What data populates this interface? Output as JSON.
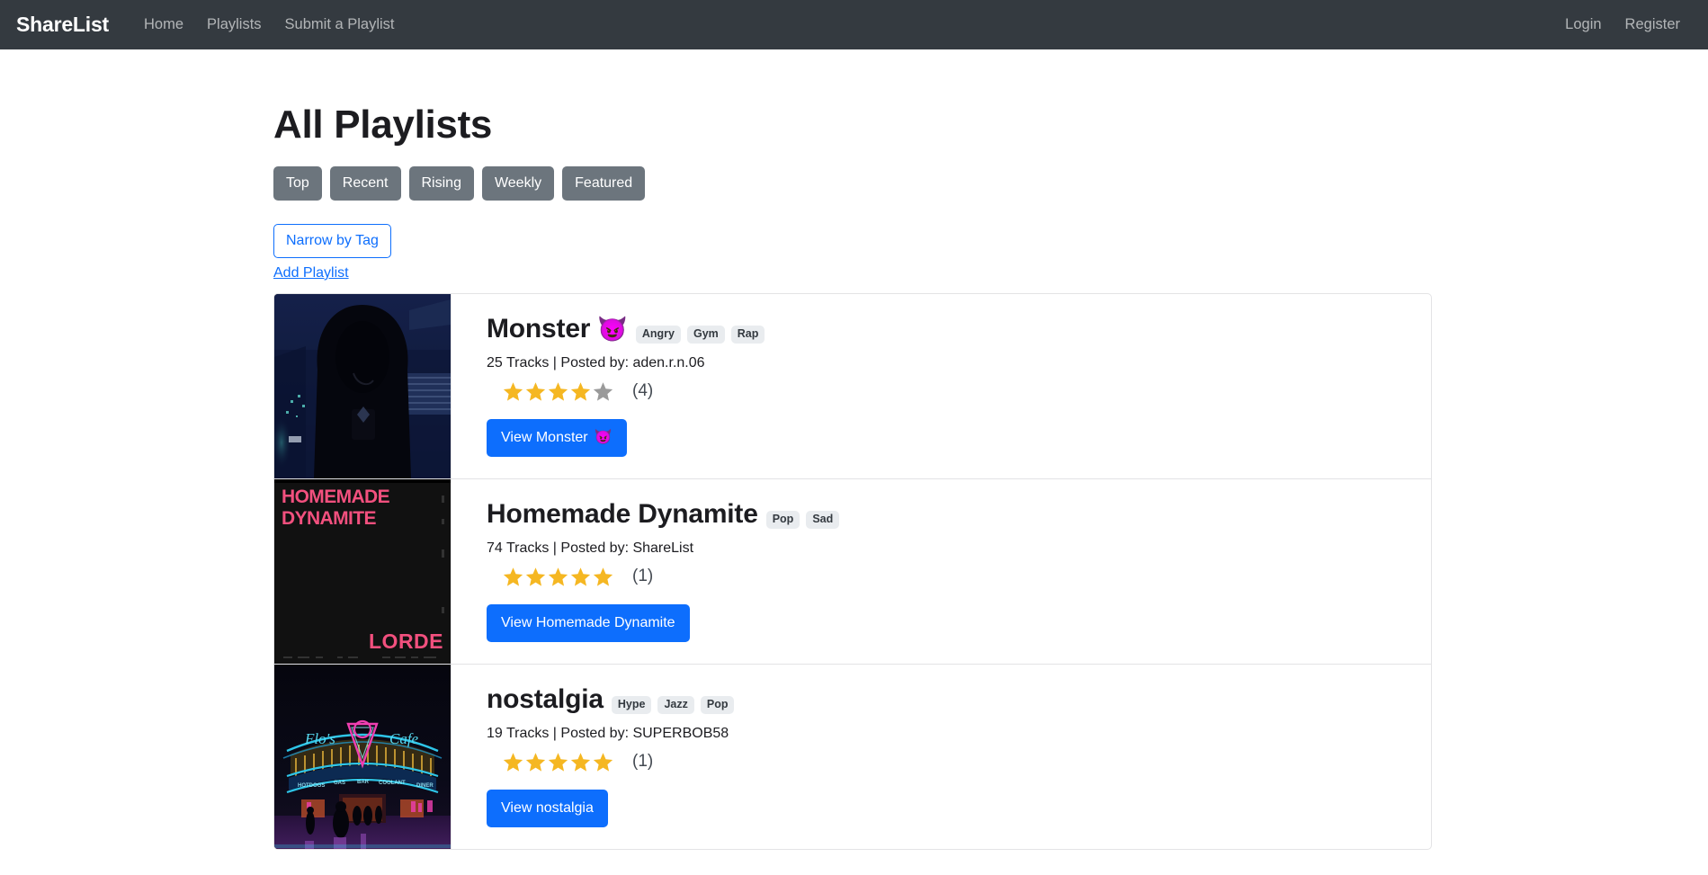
{
  "navbar": {
    "brand": "ShareList",
    "links": [
      {
        "label": "Home",
        "name": "nav-link-home"
      },
      {
        "label": "Playlists",
        "name": "nav-link-playlists"
      },
      {
        "label": "Submit a Playlist",
        "name": "nav-link-submit-a-playlist"
      }
    ],
    "right_links": [
      {
        "label": "Login",
        "name": "nav-link-login"
      },
      {
        "label": "Register",
        "name": "nav-link-register"
      }
    ]
  },
  "main": {
    "page_title": "All Playlists",
    "filters": [
      {
        "label": "Top"
      },
      {
        "label": "Recent"
      },
      {
        "label": "Rising"
      },
      {
        "label": "Weekly"
      },
      {
        "label": "Featured"
      }
    ],
    "narrow_by_tag_label": "Narrow by Tag",
    "add_playlist_label": "Add Playlist",
    "playlists": [
      {
        "title": "Monster",
        "title_emoji": "😈",
        "tags": [
          "Angry",
          "Gym",
          "Rap"
        ],
        "meta": "25 Tracks | Posted by: aden.r.n.06",
        "rating": 4,
        "rating_count": "(4)",
        "view_label": "View Monster",
        "view_emoji": "😈",
        "thumb": "dark-hooded-figure"
      },
      {
        "title": "Homemade Dynamite",
        "title_emoji": "",
        "tags": [
          "Pop",
          "Sad"
        ],
        "meta": "74 Tracks | Posted by: ShareList",
        "rating": 5,
        "rating_count": "(1)",
        "view_label": "View Homemade Dynamite",
        "view_emoji": "",
        "thumb": "lorde-album-cover"
      },
      {
        "title": "nostalgia",
        "title_emoji": "",
        "tags": [
          "Hype",
          "Jazz",
          "Pop"
        ],
        "meta": "19 Tracks | Posted by: SUPERBOB58",
        "rating": 5,
        "rating_count": "(1)",
        "view_label": "View nostalgia",
        "view_emoji": "",
        "thumb": "neon-diner-night"
      }
    ]
  },
  "colors": {
    "navbar_bg": "#343a40",
    "primary": "#0d6efd",
    "secondary": "#6c757d",
    "star_filled": "#f5b722",
    "star_empty": "#9a9a9a",
    "tag_bg": "#e9ecef"
  },
  "album_art": {
    "homemade_dynamite_line1": "HOMEMADE",
    "homemade_dynamite_line2": "DYNAMITE",
    "homemade_dynamite_artist": "LORDE",
    "neon_diner_sign_left": "Flo's",
    "neon_diner_sign_v8": "V8",
    "neon_diner_sign_right": "Cafe"
  }
}
